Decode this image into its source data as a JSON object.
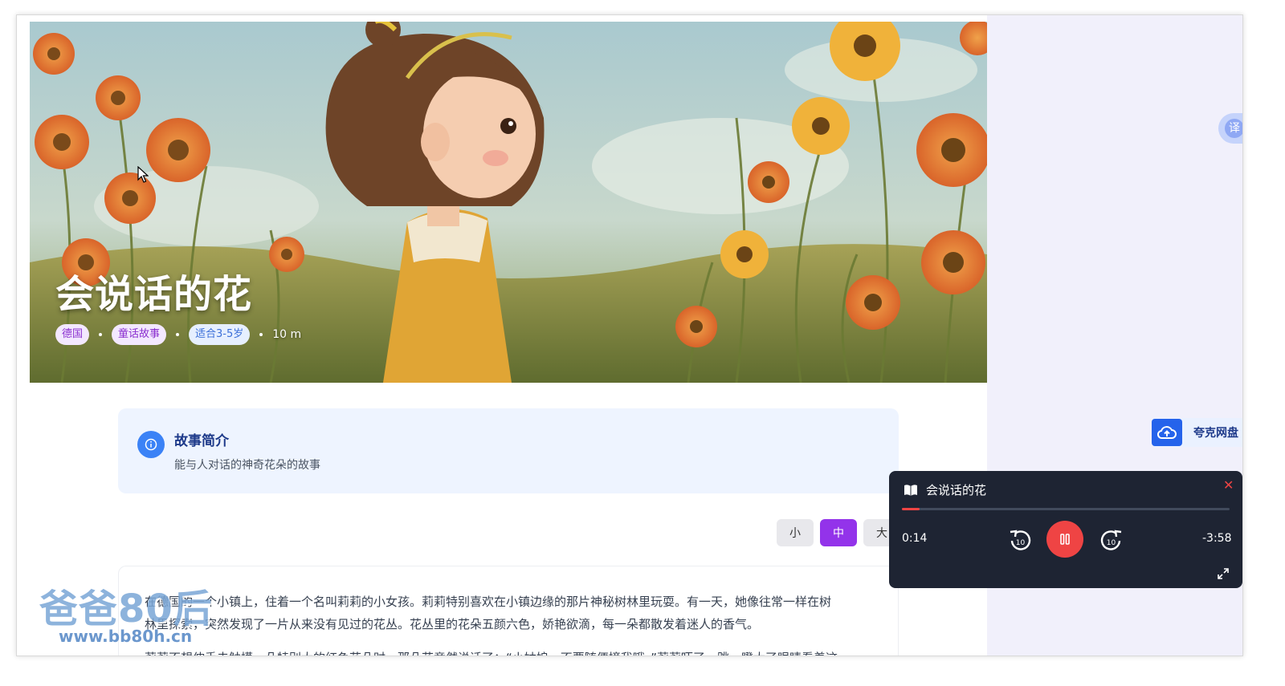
{
  "story": {
    "title": "会说话的花",
    "tags": [
      "德国",
      "童话故事",
      "适合3-5岁"
    ],
    "duration": "10 m"
  },
  "summary": {
    "heading": "故事简介",
    "text": "能与人对话的神奇花朵的故事"
  },
  "font_size": {
    "options": [
      "小",
      "中",
      "大"
    ],
    "selected": "中"
  },
  "body": {
    "paragraph_1_line_1": "在德国的一个小镇上，住着一个名叫莉莉的小女孩。莉莉特别喜欢在小镇边缘的那片神秘树林里玩耍。有一天，她像往常一样在树",
    "paragraph_1_line_2": "林里探索，突然发现了一片从来没有见过的花丛。花丛里的花朵五颜六色，娇艳欲滴，每一朵都散发着迷人的香气。",
    "paragraph_2_partial": "莉莉不想伸手去触摸一朵特别大的红色花朵时，那朵花竟然说话了：“小姑娘，不要随便摘我哦。”莉莉吓了一跳，瞪大了眼睛看着这"
  },
  "watermark": {
    "name": "爸爸80后",
    "url": "www.bb80h.cn"
  },
  "translate": {
    "label": "译"
  },
  "quark": {
    "label": "夸克网盘"
  },
  "player": {
    "title": "会说话的花",
    "current_time": "0:14",
    "remaining_time": "-3:58",
    "progress": 0.055,
    "skip_seconds": "10",
    "state": "playing",
    "close_glyph": "✕"
  },
  "colors": {
    "accent_purple": "#9333ea",
    "player_red": "#ef4444",
    "player_bg": "#1e2433",
    "summary_bg": "#eef4ff"
  }
}
